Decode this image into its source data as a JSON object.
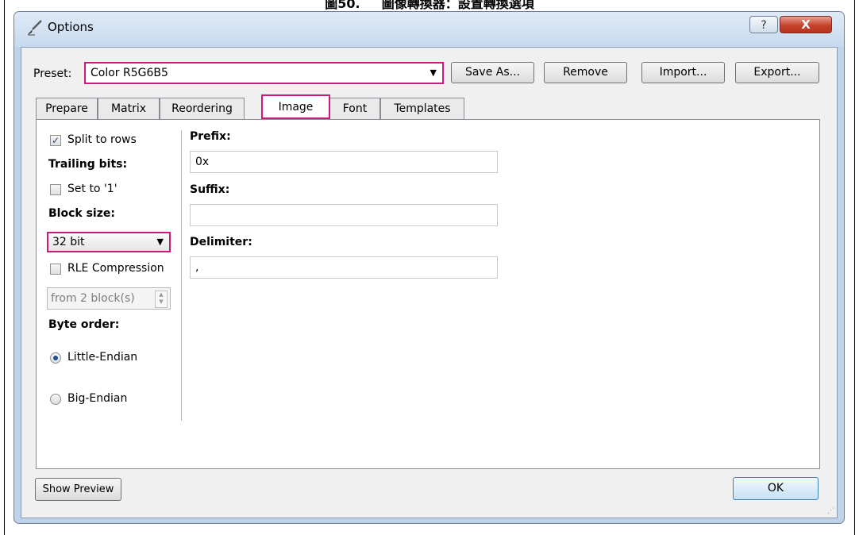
{
  "window": {
    "title": "Options",
    "help_symbol": "?",
    "close_symbol": "X"
  },
  "preset": {
    "label": "Preset:",
    "value": "Color R5G6B5",
    "buttons": {
      "save_as": "Save As...",
      "remove": "Remove",
      "import": "Import...",
      "export": "Export..."
    }
  },
  "tabs": [
    {
      "label": "Prepare",
      "active": false
    },
    {
      "label": "Matrix",
      "active": false
    },
    {
      "label": "Reordering",
      "active": false
    },
    {
      "label": "Image",
      "active": true
    },
    {
      "label": "Font",
      "active": false
    },
    {
      "label": "Templates",
      "active": false
    }
  ],
  "image_tab": {
    "split_to_rows": {
      "label": "Split to rows",
      "checked": true
    },
    "trailing_bits": {
      "heading": "Trailing bits:",
      "set_to_one": {
        "label": "Set to '1'",
        "checked": false
      }
    },
    "block_size": {
      "heading": "Block size:",
      "value": "32 bit"
    },
    "rle": {
      "label": "RLE Compression",
      "checked": false,
      "from_blocks": "from 2 block(s)"
    },
    "byte_order": {
      "heading": "Byte order:",
      "options": [
        {
          "label": "Little-Endian",
          "selected": true
        },
        {
          "label": "Big-Endian",
          "selected": false
        }
      ]
    },
    "prefix": {
      "label": "Prefix:",
      "value": "0x"
    },
    "suffix": {
      "label": "Suffix:",
      "value": ""
    },
    "delimiter": {
      "label": "Delimiter:",
      "value": ","
    }
  },
  "footer": {
    "show_preview": "Show Preview",
    "ok": "OK"
  },
  "colors": {
    "highlight": "#d0177a",
    "window_frame": "#bfd4ea",
    "close_red": "#c5432c"
  }
}
